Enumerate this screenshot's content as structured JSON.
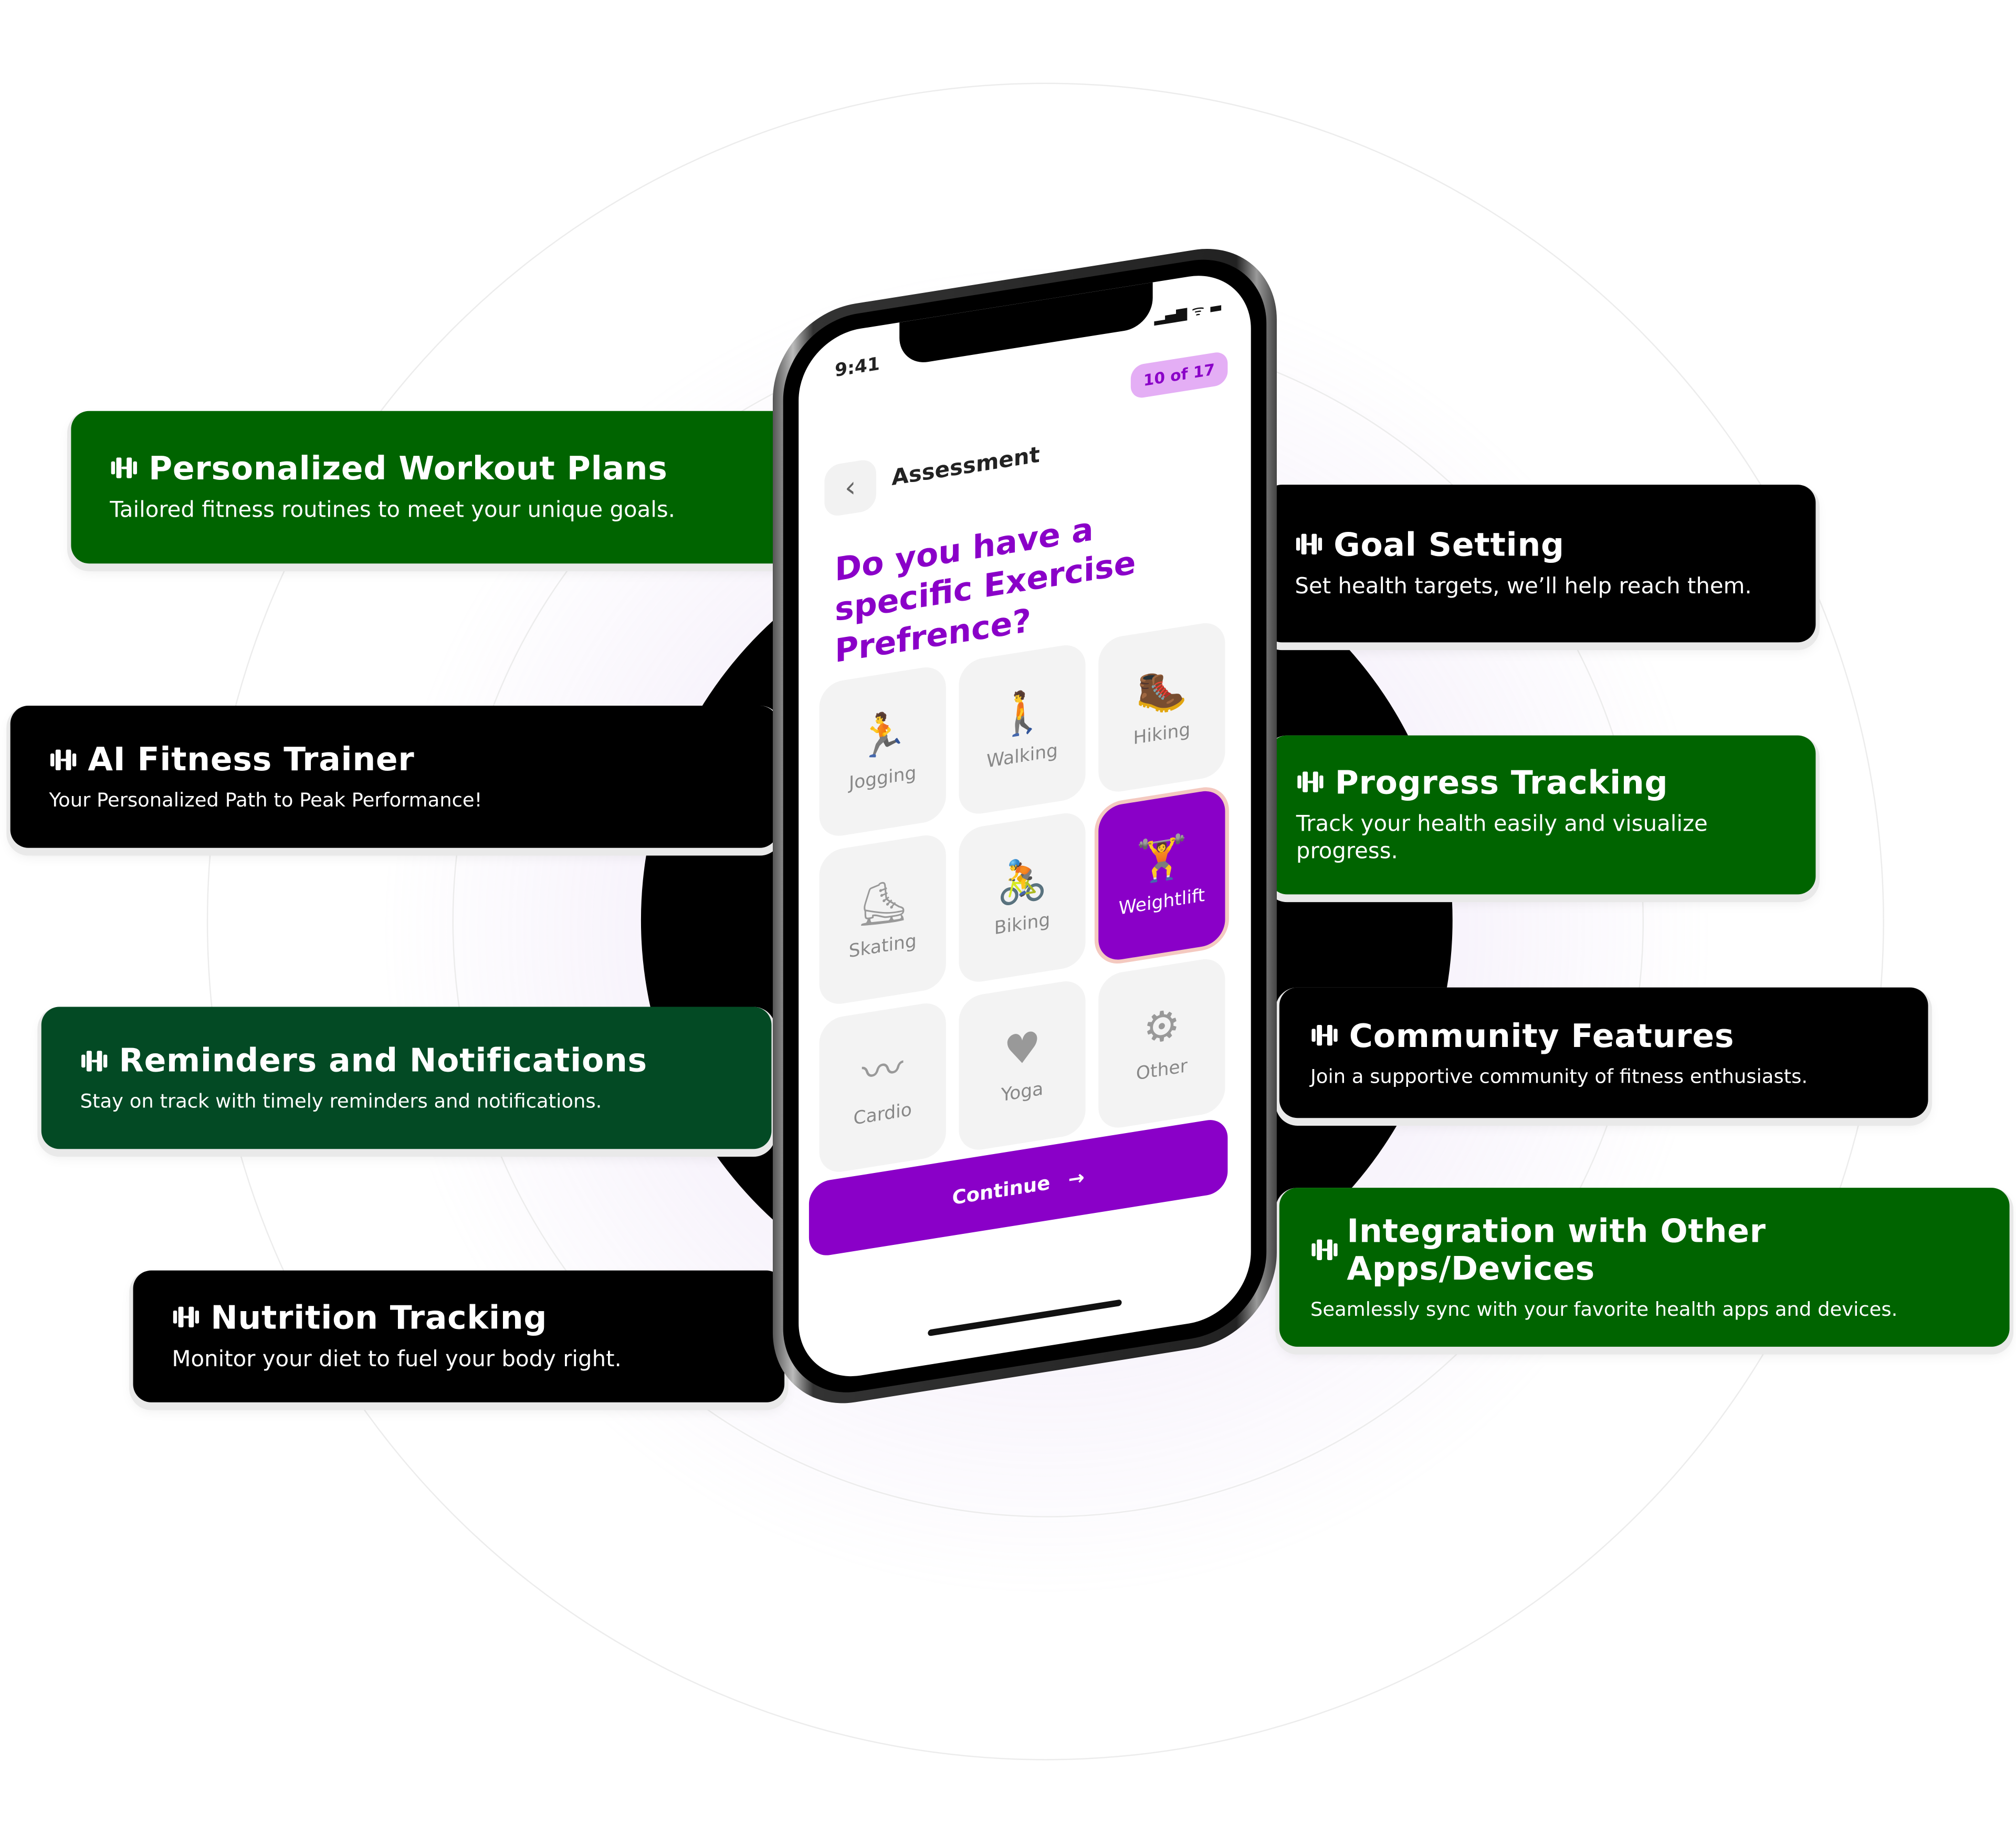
{
  "colors": {
    "green": "#006400",
    "dark_green": "#034a24",
    "black": "#000000",
    "purple": "#8a00c8",
    "badge_bg": "#e4aef5"
  },
  "features_left": [
    {
      "icon": "dumbbell-icon",
      "title": "Personalized Workout Plans",
      "desc": "Tailored fitness routines to meet your unique goals."
    },
    {
      "icon": "dumbbell-icon",
      "title": "AI Fitness Trainer",
      "desc": "Your Personalized Path to Peak Performance!"
    },
    {
      "icon": "dumbbell-icon",
      "title": "Reminders and Notifications",
      "desc": "Stay on track with timely reminders and notifications."
    },
    {
      "icon": "dumbbell-icon",
      "title": "Nutrition Tracking",
      "desc": "Monitor your diet to fuel your body right."
    }
  ],
  "features_right": [
    {
      "icon": "dumbbell-icon",
      "title": "Goal Setting",
      "desc": "Set health targets, we’ll help reach them."
    },
    {
      "icon": "dumbbell-icon",
      "title": "Progress Tracking",
      "desc": "Track your health easily and visualize progress."
    },
    {
      "icon": "dumbbell-icon",
      "title": "Community Features",
      "desc": "Join a supportive community of fitness enthusiasts."
    },
    {
      "icon": "dumbbell-icon",
      "title": "Integration with Other Apps/Devices",
      "desc": "Seamlessly sync with your favorite health apps and devices."
    }
  ],
  "phone": {
    "time": "9:41",
    "status_icons": "▂▄▆ ᯤ ▬",
    "progress_badge": "10 of 17",
    "back_icon": "‹",
    "title": "Assessment",
    "question": "Do you have a specific Exercise Prefrence?",
    "options": [
      {
        "label": "Jogging",
        "icon": "🏃"
      },
      {
        "label": "Walking",
        "icon": "🚶"
      },
      {
        "label": "Hiking",
        "icon": "🥾"
      },
      {
        "label": "Skating",
        "icon": "⛸"
      },
      {
        "label": "Biking",
        "icon": "🚴"
      },
      {
        "label": "Weightlift",
        "icon": "🏋",
        "selected": true
      },
      {
        "label": "Cardio",
        "icon": "〰"
      },
      {
        "label": "Yoga",
        "icon": "♥"
      },
      {
        "label": "Other",
        "icon": "⚙"
      }
    ],
    "continue_label": "Continue",
    "continue_icon": "→"
  }
}
